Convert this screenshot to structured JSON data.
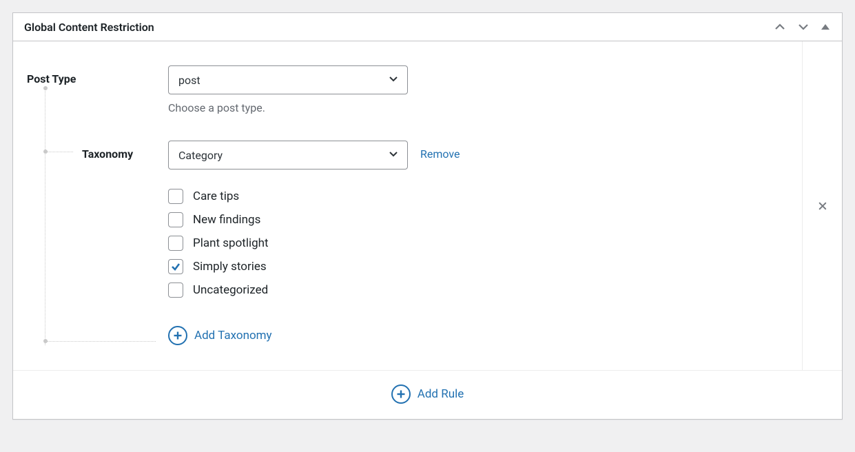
{
  "panel": {
    "title": "Global Content Restriction"
  },
  "rule": {
    "post_type": {
      "label": "Post Type",
      "value": "post",
      "helper": "Choose a post type."
    },
    "taxonomy": {
      "label": "Taxonomy",
      "value": "Category",
      "remove_label": "Remove",
      "terms": [
        {
          "label": "Care tips",
          "checked": false
        },
        {
          "label": "New findings",
          "checked": false
        },
        {
          "label": "Plant spotlight",
          "checked": false
        },
        {
          "label": "Simply stories",
          "checked": true
        },
        {
          "label": "Uncategorized",
          "checked": false
        }
      ],
      "add_label": "Add Taxonomy"
    }
  },
  "footer": {
    "add_rule_label": "Add Rule"
  }
}
